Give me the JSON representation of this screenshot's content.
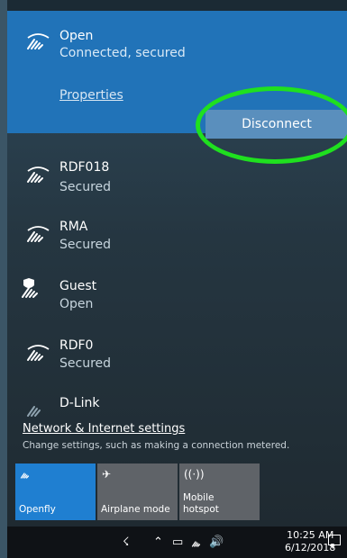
{
  "networks": [
    {
      "name": "Open",
      "status": "Connected, secured",
      "icon": "wifi-icon"
    },
    {
      "name": "RDF018",
      "status": "Secured",
      "icon": "wifi-icon"
    },
    {
      "name": "RMA",
      "status": "Secured",
      "icon": "wifi-icon"
    },
    {
      "name": "Guest",
      "status": "Open",
      "icon": "wifi-shield-icon"
    },
    {
      "name": "RDF0",
      "status": "Secured",
      "icon": "wifi-icon"
    },
    {
      "name": "D-Link",
      "status": "",
      "icon": "wifi-icon"
    }
  ],
  "selected": {
    "properties_label": "Properties",
    "disconnect_label": "Disconnect"
  },
  "settings": {
    "link": "Network & Internet settings",
    "hint": "Change settings, such as making a connection metered."
  },
  "tiles": [
    {
      "label": "Openfly",
      "icon": "wifi-icon",
      "state": "on"
    },
    {
      "label": "Airplane mode",
      "icon": "airplane-icon",
      "state": "off"
    },
    {
      "label": "Mobile\nhotspot",
      "icon": "hotspot-icon",
      "state": "off"
    }
  ],
  "taskbar": {
    "time": "10:25 AM",
    "date": "6/12/2018"
  },
  "colors": {
    "accent": "#2173b8",
    "highlight": "#1fe01f",
    "tile_on": "#1f7fd1",
    "tile_off": "#5f6368"
  }
}
